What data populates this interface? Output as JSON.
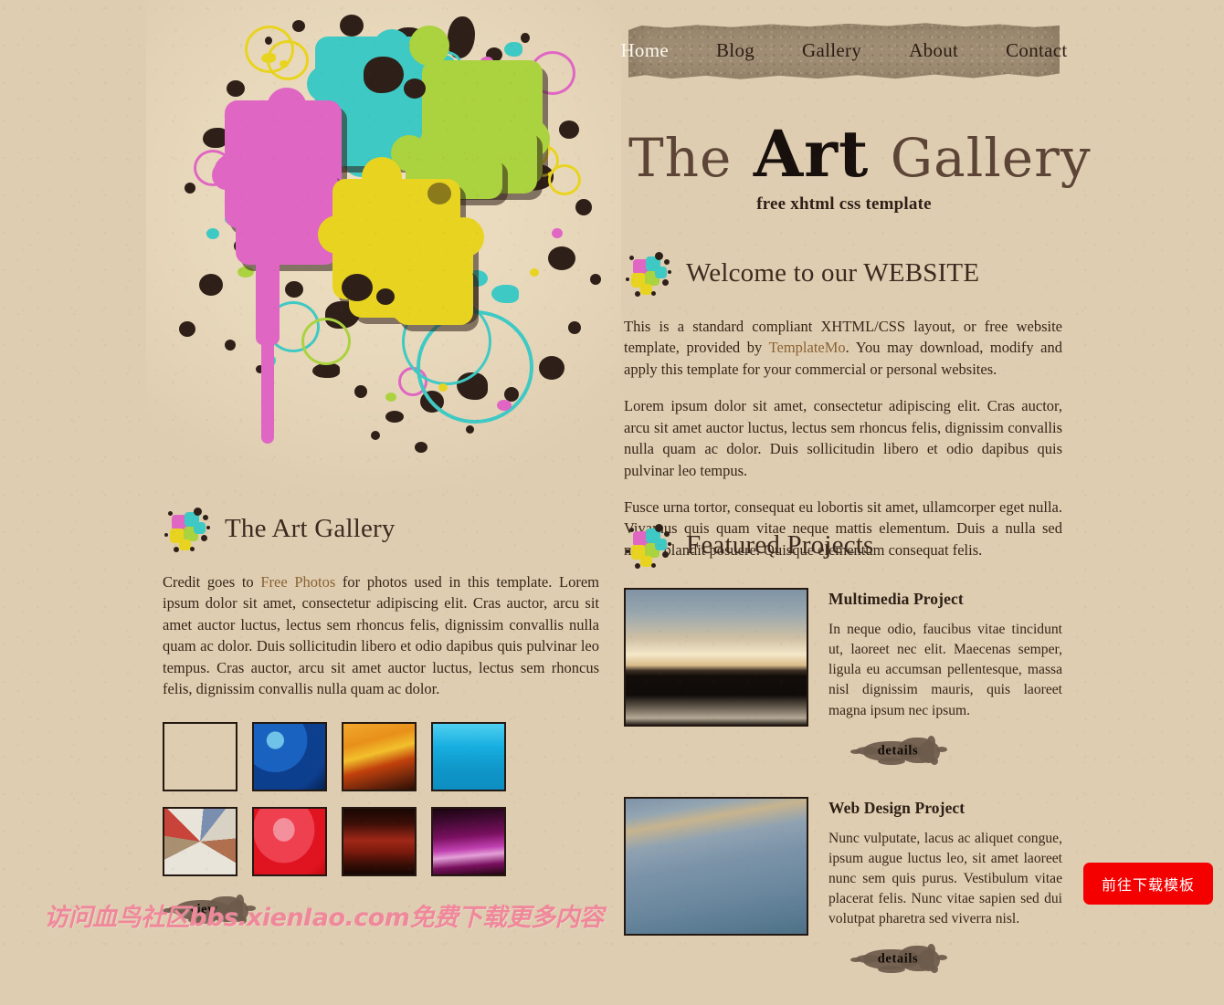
{
  "site": {
    "title_part1": "The",
    "title_part2": "Art",
    "title_part3": "Gallery",
    "tagline": "free xhtml css template",
    "background_color": "#dfcdb1",
    "accent_link_color": "#8a6233",
    "nav_tape_color": "#a28f76"
  },
  "nav": {
    "items": [
      {
        "label": "Home",
        "active": true
      },
      {
        "label": "Blog",
        "active": false
      },
      {
        "label": "Gallery",
        "active": false
      },
      {
        "label": "About",
        "active": false
      },
      {
        "label": "Contact",
        "active": false
      }
    ]
  },
  "header_art": {
    "icon_name": "puzzle-splatter-artwork",
    "piece_colors": [
      "#3fc9c4",
      "#e066c4",
      "#abd23f",
      "#e8d420"
    ],
    "splatter_color": "#2e2018"
  },
  "welcome": {
    "icon_name": "puzzle-splatter-icon",
    "heading": "Welcome to our WEBSITE",
    "paragraph1_before_link": "This is a standard compliant XHTML/CSS layout, or free website template, provided by ",
    "link_label": "TemplateMo",
    "paragraph1_after_link": ". You may download, modify and apply this template for your commercial or personal websites.",
    "paragraph2": "Lorem ipsum dolor sit amet, consectetur adipiscing elit. Cras auctor, arcu sit amet auctor luctus, lectus sem rhoncus felis, dignissim convallis nulla quam ac dolor. Duis sollicitudin libero et odio dapibus quis pulvinar leo tempus.",
    "paragraph3": "Fusce urna tortor, consequat eu lobortis sit amet, ullamcorper eget nulla. Vivamus quis quam vitae neque mattis elementum. Duis a nulla sed metus blandit posuere. Quisque elementum consequat felis."
  },
  "gallery": {
    "icon_name": "puzzle-splatter-icon",
    "heading": "The Art Gallery",
    "credit_before_link": "Credit goes to ",
    "credit_link_label": "Free Photos",
    "credit_after_link": " for photos used in this template. Lorem ipsum dolor sit amet, consectetur adipiscing elit. Cras auctor, arcu sit amet auctor luctus, lectus sem rhoncus felis, dignissim convallis nulla quam ac dolor. Duis sollicitudin libero et odio dapibus quis pulvinar leo tempus. Cras auctor, arcu sit amet auctor luctus, lectus sem rhoncus felis, dignissim convallis nulla quam ac dolor.",
    "view_button_label": "view",
    "thumbnails": [
      {
        "name": "thumb-pencils-wood",
        "colors": [
          "#b09574",
          "#8a6b4a",
          "#d8c4a2"
        ]
      },
      {
        "name": "thumb-blue-paint",
        "colors": [
          "#1a62c0",
          "#0d3f8f",
          "#6fc2e8"
        ]
      },
      {
        "name": "thumb-orange-fire",
        "colors": [
          "#e8901a",
          "#f2c02c",
          "#7a2a0c"
        ]
      },
      {
        "name": "thumb-cyan-water",
        "colors": [
          "#12a8dc",
          "#0d8ec2",
          "#4fd0f0"
        ]
      },
      {
        "name": "thumb-colored-pencils",
        "colors": [
          "#e8e4da",
          "#a89070",
          "#c8443a"
        ]
      },
      {
        "name": "thumb-red-gradient",
        "colors": [
          "#ef4050",
          "#d8101a",
          "#f08090"
        ]
      },
      {
        "name": "thumb-dark-red-texture",
        "colors": [
          "#a02818",
          "#5a1008",
          "#1a0804"
        ]
      },
      {
        "name": "thumb-magenta-texture",
        "colors": [
          "#c040b0",
          "#7a1060",
          "#1a0410"
        ]
      }
    ]
  },
  "featured": {
    "icon_name": "puzzle-splatter-icon",
    "heading": "Featured Projects",
    "projects": [
      {
        "image_name": "project-image-sunset-lake",
        "title": "Multimedia Project",
        "text": "In neque odio, faucibus vitae tincidunt ut, laoreet nec elit. Maecenas semper, ligula eu accumsan pellentesque, massa nisl dignissim mauris, quis laoreet magna ipsum nec ipsum.",
        "button_label": "details"
      },
      {
        "image_name": "project-image-boat-water",
        "title": "Web Design Project",
        "text": "Nunc vulputate, lacus ac aliquet congue, ipsum augue luctus leo, sit amet laoreet nunc sem quis purus. Vestibulum vitae placerat felis. Nunc vitae sapien sed dui volutpat pharetra sed viverra nisl.",
        "button_label": "details"
      }
    ]
  },
  "overlay": {
    "watermark_text": "访问血鸟社区bbs.xienIao.com免费下载更多内容",
    "watermark_color": "#f0889b",
    "download_button_label": "前往下载模板",
    "download_button_color": "#f40000"
  }
}
